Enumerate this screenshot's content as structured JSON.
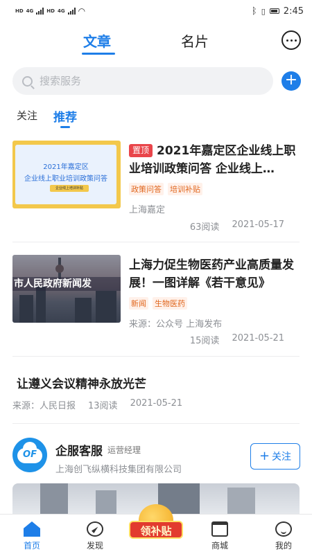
{
  "status_bar": {
    "net1": "4G",
    "net2": "4G",
    "hd": "HD",
    "time": "2:45"
  },
  "top_tabs": [
    {
      "label": "文章",
      "active": true
    },
    {
      "label": "名片",
      "active": false
    }
  ],
  "search": {
    "placeholder": "搜索服务"
  },
  "sub_tabs": [
    {
      "label": "关注",
      "active": false
    },
    {
      "label": "推荐",
      "active": true
    }
  ],
  "articles": [
    {
      "pin": "置顶",
      "title": "2021年嘉定区企业线上职业培训政策问答 企业线上…",
      "thumb_line1": "2021年嘉定区",
      "thumb_line2": "企业线上职业培训政策问答",
      "thumb_tag": "企业线上培训补贴",
      "tags": [
        "政策问答",
        "培训补贴"
      ],
      "source": "上海嘉定",
      "reads": "63阅读",
      "date": "2021-05-17"
    },
    {
      "title": "上海力促生物医药产业高质量发展！一图详解《若干意见》",
      "thumb_caption": "市人民政府新闻发",
      "tags": [
        "新闻",
        "生物医药"
      ],
      "source": "来源：公众号 上海发布",
      "reads": "15阅读",
      "date": "2021-05-21"
    },
    {
      "title": "让遵义会议精神永放光芒",
      "source": "来源：人民日报",
      "reads": "13阅读",
      "date": "2021-05-21"
    }
  ],
  "service": {
    "logo_text": "OF",
    "name": "企服客服",
    "role": "运营经理",
    "company": "上海创飞纵横科技集团有限公司",
    "follow_label": "关注"
  },
  "bottom_nav": [
    {
      "label": "首页",
      "icon": "home-icon",
      "active": true
    },
    {
      "label": "发现",
      "icon": "compass-icon",
      "active": false
    },
    {
      "label": "领补贴",
      "icon": "subsidy-coin-icon",
      "active": false
    },
    {
      "label": "商城",
      "icon": "shop-icon",
      "active": false
    },
    {
      "label": "我的",
      "icon": "profile-icon",
      "active": false
    }
  ],
  "colors": {
    "accent": "#1e7ee8",
    "pin_red": "#e9454a",
    "tag_orange": "#e0671f"
  }
}
